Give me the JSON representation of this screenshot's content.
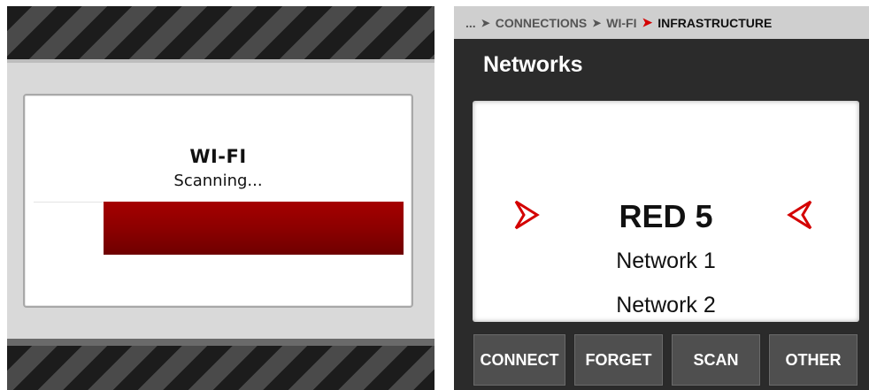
{
  "wifi_dialog": {
    "title": "WI-FI",
    "status": "Scanning...",
    "progress": 0.81,
    "colors": {
      "progress": "#8a0000"
    }
  },
  "networks_screen": {
    "breadcrumb": {
      "ellipsis": "...",
      "items": [
        "CONNECTIONS",
        "WI-FI"
      ],
      "current": "INFRASTRUCTURE",
      "separator_icon": "chevron-right-icon"
    },
    "title": "Networks",
    "networks": {
      "selected": "RED 5",
      "items": [
        "Network 1",
        "Network 2"
      ],
      "selector_icons": [
        "right-pointer-arrow-icon",
        "left-pointer-arrow-icon"
      ]
    },
    "buttons": {
      "connect": "CONNECT",
      "forget": "FORGET",
      "scan": "SCAN",
      "other": "OTHER"
    },
    "colors": {
      "accent": "#d40000",
      "background": "#2b2b2b",
      "button": "#4f4f4f"
    }
  }
}
